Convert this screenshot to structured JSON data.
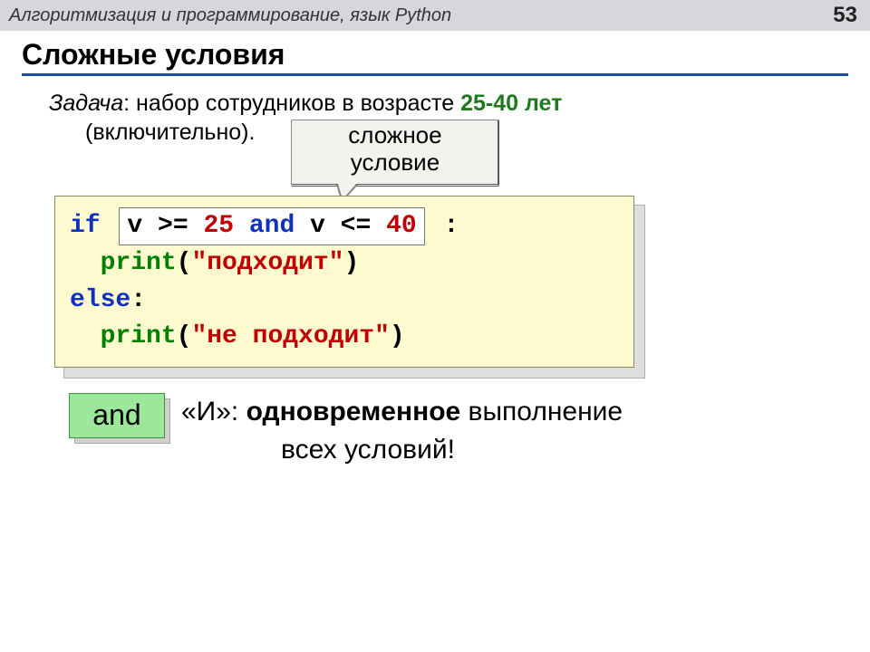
{
  "header": {
    "title": "Алгоритмизация и программирование, язык Python",
    "page_number": "53"
  },
  "section_title": "Сложные условия",
  "task": {
    "label": "Задача",
    "text_before_range": ": набор сотрудников в возрасте ",
    "range": "25-40 лет",
    "line2": "(включительно)."
  },
  "callout": {
    "line1": "сложное",
    "line2": "условие"
  },
  "code": {
    "if_kw": "if",
    "cond_v1": "v >= ",
    "cond_n1": "25",
    "cond_and": " and ",
    "cond_v2": "v <= ",
    "cond_n2": "40",
    "colon": ":",
    "print_kw": "print",
    "str_ok": "\"подходит\"",
    "else_kw": "else",
    "str_no": "\"не подходит\""
  },
  "and_block": {
    "badge": "and",
    "quote_open": "«И»: ",
    "bold_word": "одновременное",
    "rest1": " выполнение",
    "rest2": "всех условий!"
  }
}
